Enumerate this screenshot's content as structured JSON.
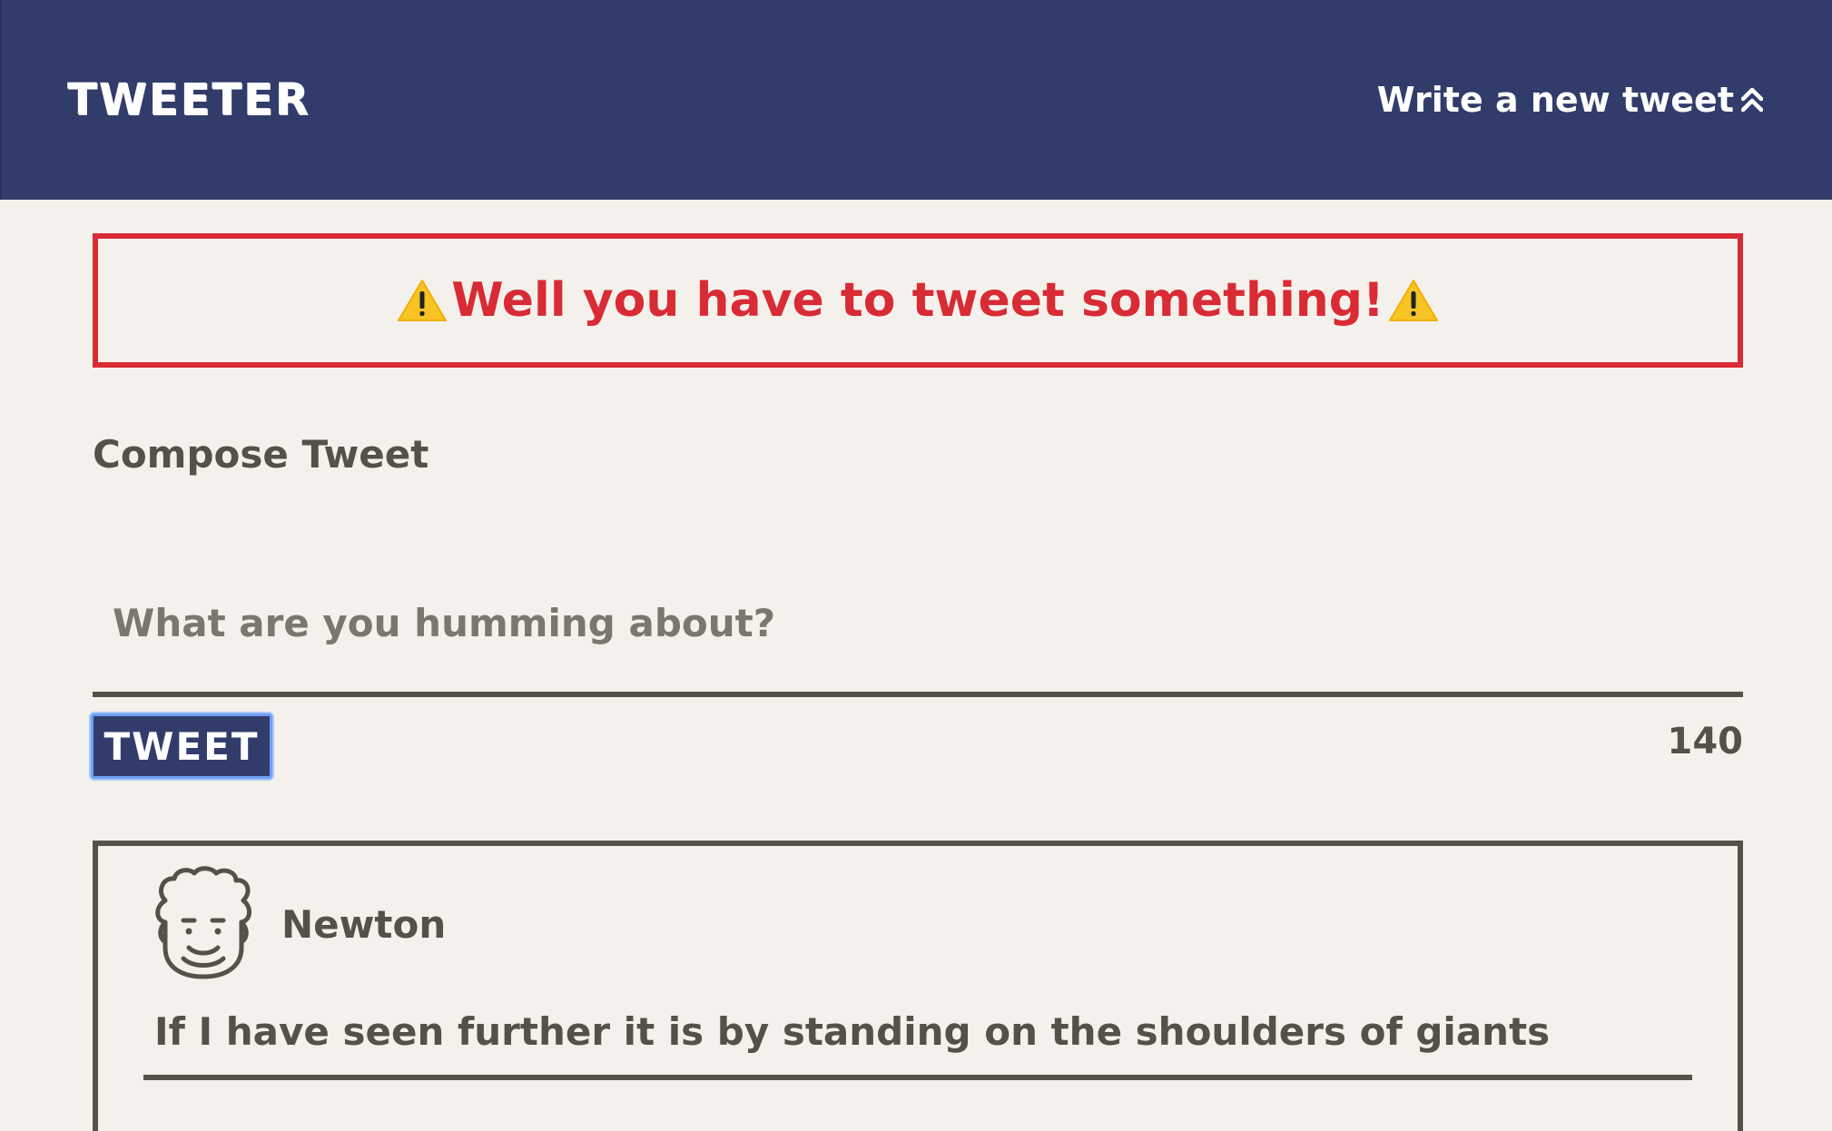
{
  "header": {
    "brand": "TWEETER",
    "toggle_label": "Write a new tweet",
    "toggle_icon": "double-chevron-up-icon"
  },
  "error": {
    "message": "Well you have to tweet something!",
    "icon": "warning-icon",
    "color": "#d92b35"
  },
  "compose": {
    "title": "Compose Tweet",
    "placeholder": "What are you humming about?",
    "value": "",
    "button_label": "TWEET",
    "counter": "140"
  },
  "tweets": [
    {
      "name": "Newton",
      "avatar_icon": "newton-avatar-icon",
      "content": "If I have seen further it is by standing on the shoulders of giants"
    }
  ],
  "colors": {
    "nav_bg": "#323c6b",
    "page_bg": "#f4f1ec",
    "text": "#545149",
    "error": "#d92b35"
  }
}
